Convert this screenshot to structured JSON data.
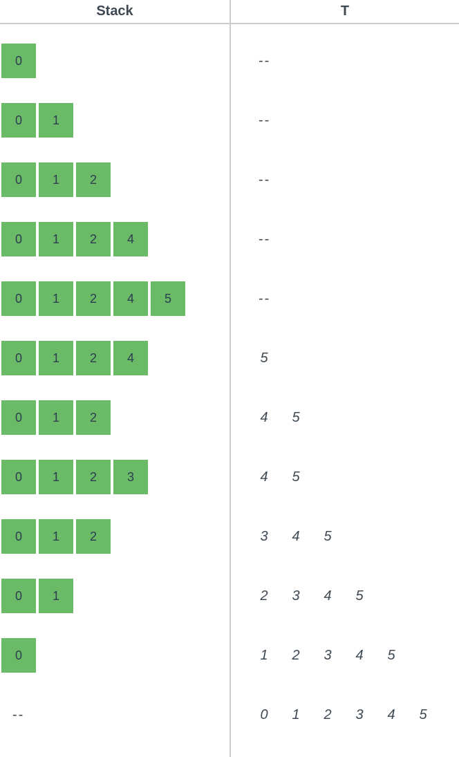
{
  "headers": {
    "stack": "Stack",
    "t": "T"
  },
  "empty_placeholder": "--",
  "rows": [
    {
      "stack": [
        0
      ],
      "t": []
    },
    {
      "stack": [
        0,
        1
      ],
      "t": []
    },
    {
      "stack": [
        0,
        1,
        2
      ],
      "t": []
    },
    {
      "stack": [
        0,
        1,
        2,
        4
      ],
      "t": []
    },
    {
      "stack": [
        0,
        1,
        2,
        4,
        5
      ],
      "t": []
    },
    {
      "stack": [
        0,
        1,
        2,
        4
      ],
      "t": [
        5
      ]
    },
    {
      "stack": [
        0,
        1,
        2
      ],
      "t": [
        4,
        5
      ]
    },
    {
      "stack": [
        0,
        1,
        2,
        3
      ],
      "t": [
        4,
        5
      ]
    },
    {
      "stack": [
        0,
        1,
        2
      ],
      "t": [
        3,
        4,
        5
      ]
    },
    {
      "stack": [
        0,
        1
      ],
      "t": [
        2,
        3,
        4,
        5
      ]
    },
    {
      "stack": [
        0
      ],
      "t": [
        1,
        2,
        3,
        4,
        5
      ]
    },
    {
      "stack": [],
      "t": [
        0,
        1,
        2,
        3,
        4,
        5
      ]
    }
  ]
}
